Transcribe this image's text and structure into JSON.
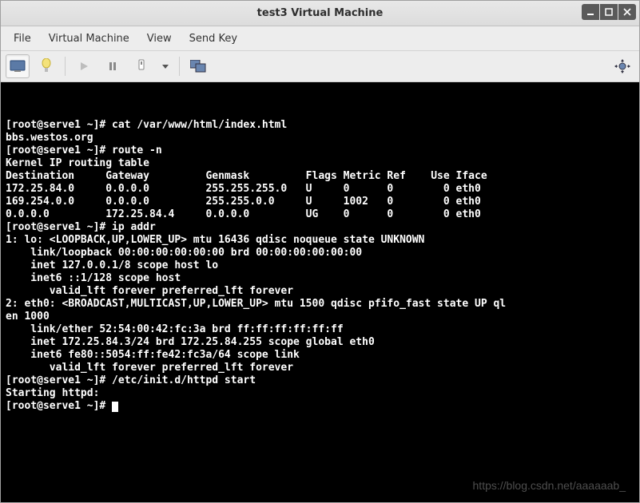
{
  "window": {
    "title": "test3 Virtual Machine"
  },
  "menu": {
    "file": "File",
    "vm": "Virtual Machine",
    "view": "View",
    "sendkey": "Send Key"
  },
  "terminal": {
    "lines": [
      "[root@serve1 ~]# cat /var/www/html/index.html",
      "bbs.westos.org",
      "[root@serve1 ~]# route -n",
      "Kernel IP routing table",
      "Destination     Gateway         Genmask         Flags Metric Ref    Use Iface",
      "172.25.84.0     0.0.0.0         255.255.255.0   U     0      0        0 eth0",
      "169.254.0.0     0.0.0.0         255.255.0.0     U     1002   0        0 eth0",
      "0.0.0.0         172.25.84.4     0.0.0.0         UG    0      0        0 eth0",
      "[root@serve1 ~]# ip addr",
      "1: lo: <LOOPBACK,UP,LOWER_UP> mtu 16436 qdisc noqueue state UNKNOWN ",
      "    link/loopback 00:00:00:00:00:00 brd 00:00:00:00:00:00",
      "    inet 127.0.0.1/8 scope host lo",
      "    inet6 ::1/128 scope host ",
      "       valid_lft forever preferred_lft forever",
      "2: eth0: <BROADCAST,MULTICAST,UP,LOWER_UP> mtu 1500 qdisc pfifo_fast state UP ql",
      "en 1000",
      "    link/ether 52:54:00:42:fc:3a brd ff:ff:ff:ff:ff:ff",
      "    inet 172.25.84.3/24 brd 172.25.84.255 scope global eth0",
      "    inet6 fe80::5054:ff:fe42:fc3a/64 scope link ",
      "       valid_lft forever preferred_lft forever",
      "[root@serve1 ~]# /etc/init.d/httpd start",
      "Starting httpd: ",
      "[root@serve1 ~]# "
    ]
  },
  "watermark": "https://blog.csdn.net/aaaaaab_"
}
